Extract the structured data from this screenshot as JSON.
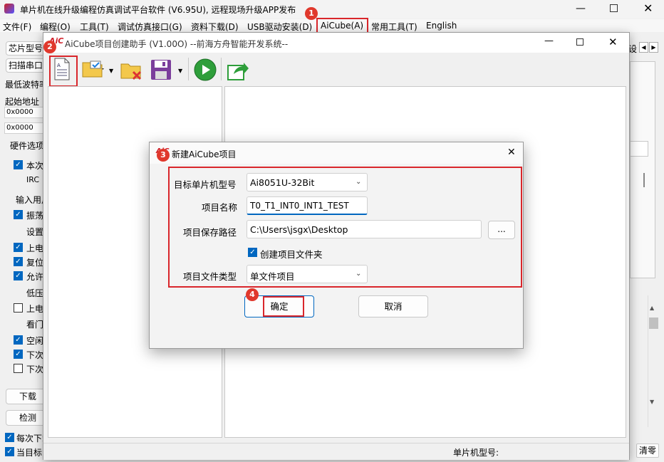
{
  "main": {
    "title": "单片机在线升级编程仿真调试平台软件 (V6.95U), 远程现场升级APP发布",
    "menu": [
      "文件(F)",
      "编程(O)",
      "工具(T)",
      "调试仿真接口(G)",
      "资料下载(D)",
      "USB驱动安装(D)",
      "AiCube(A)",
      "常用工具(T)",
      "English"
    ],
    "left": {
      "chip_label": "芯片型号",
      "scan_label": "扫描串口",
      "baud_label": "最低波特率",
      "addr_label": "起始地址",
      "addr1": "0x0000",
      "addr2": "0x0000",
      "hw_label": "硬件选项",
      "opts": [
        "本次",
        "IRC",
        "输入用户",
        "振荡",
        "设置",
        "上电",
        "复位",
        "允许",
        "低压",
        "上电",
        "看门",
        "空闲",
        "下次",
        "下次"
      ],
      "download_label": "下载",
      "detect_label": "检测",
      "bottom1": "每次下载",
      "bottom2": "当目标"
    },
    "right_btn_label": "设",
    "status_label": "单片机型号:",
    "clear_label": "清零"
  },
  "wizard": {
    "title": "AiCube项目创建助手 (V1.00O) --前海方舟智能开发系统--"
  },
  "dialog": {
    "title": "新建AiCube项目",
    "mcu_label": "目标单片机型号",
    "mcu_value": "Ai8051U-32Bit",
    "name_label": "项目名称",
    "name_value": "T0_T1_INT0_INT1_TEST",
    "path_label": "项目保存路径",
    "path_value": "C:\\Users\\jsgx\\Desktop",
    "browse_label": "...",
    "create_folder_label": "创建项目文件夹",
    "type_label": "项目文件类型",
    "type_value": "单文件项目",
    "ok_label": "确定",
    "cancel_label": "取消"
  },
  "badges": [
    "1",
    "2",
    "3",
    "4"
  ],
  "colors": {
    "highlight": "#d9262b",
    "badge": "#e0382c",
    "accent": "#0067c0"
  }
}
